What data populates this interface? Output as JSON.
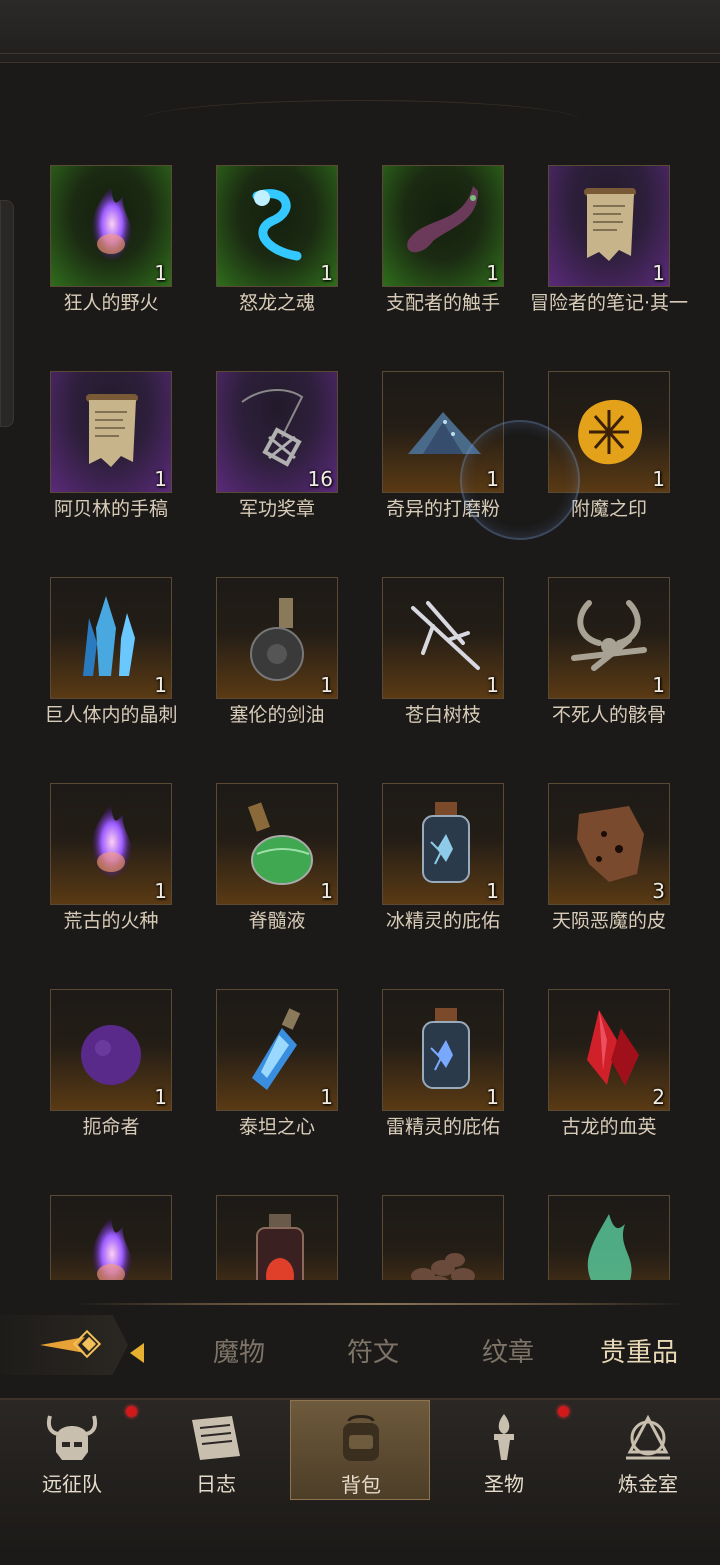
{
  "items": [
    {
      "name": "狂人的野火",
      "count": "1",
      "bg": "green",
      "icon": "purple-flame-icon",
      "color": "#9b5cff"
    },
    {
      "name": "怒龙之魂",
      "count": "1",
      "bg": "green",
      "icon": "blue-spirit-icon",
      "color": "#33c8ff"
    },
    {
      "name": "支配者的触手",
      "count": "1",
      "bg": "green",
      "icon": "tentacle-icon",
      "color": "#6b3a5a"
    },
    {
      "name": "冒险者的笔记·其一",
      "count": "1",
      "bg": "purple",
      "icon": "scroll-icon",
      "color": "#c8b48a"
    },
    {
      "name": "阿贝林的手稿",
      "count": "1",
      "bg": "purple",
      "icon": "scroll-icon",
      "color": "#c8b48a"
    },
    {
      "name": "军功奖章",
      "count": "16",
      "bg": "purple",
      "icon": "medal-icon",
      "color": "#b0b0b0"
    },
    {
      "name": "奇异的打磨粉",
      "count": "1",
      "bg": "orange",
      "icon": "powder-pile-icon",
      "color": "#4a6a8a"
    },
    {
      "name": "附魔之印",
      "count": "1",
      "bg": "orange",
      "icon": "amber-sigil-icon",
      "color": "#e3a21a"
    },
    {
      "name": "巨人体内的晶刺",
      "count": "1",
      "bg": "orange",
      "icon": "crystal-shard-icon",
      "color": "#4aa8e0"
    },
    {
      "name": "塞伦的剑油",
      "count": "1",
      "bg": "orange",
      "icon": "oil-flask-icon",
      "color": "#3a3a3a"
    },
    {
      "name": "苍白树枝",
      "count": "1",
      "bg": "orange",
      "icon": "branch-icon",
      "color": "#d8d8e0"
    },
    {
      "name": "不死人的骸骨",
      "count": "1",
      "bg": "orange",
      "icon": "bones-icon",
      "color": "#a8a294"
    },
    {
      "name": "荒古的火种",
      "count": "1",
      "bg": "orange",
      "icon": "purple-fire-icon",
      "color": "#b04cff"
    },
    {
      "name": "脊髓液",
      "count": "1",
      "bg": "orange",
      "icon": "green-potion-icon",
      "color": "#3fa850"
    },
    {
      "name": "冰精灵的庇佑",
      "count": "1",
      "bg": "orange",
      "icon": "ice-jar-icon",
      "color": "#8ecbe8"
    },
    {
      "name": "天陨恶魔的皮",
      "count": "3",
      "bg": "orange",
      "icon": "demon-hide-icon",
      "color": "#7a4a2e"
    },
    {
      "name": "扼命者",
      "count": "1",
      "bg": "orange",
      "icon": "dark-orb-icon",
      "color": "#5a2a8a"
    },
    {
      "name": "泰坦之心",
      "count": "1",
      "bg": "orange",
      "icon": "blue-crystal-vial-icon",
      "color": "#3a8ee0"
    },
    {
      "name": "雷精灵的庇佑",
      "count": "1",
      "bg": "orange",
      "icon": "thunder-jar-icon",
      "color": "#7aa8ff"
    },
    {
      "name": "古龙的血英",
      "count": "2",
      "bg": "orange",
      "icon": "red-crystal-icon",
      "color": "#d0202a"
    },
    {
      "name": "",
      "count": "",
      "bg": "orange",
      "icon": "purple-fire-icon",
      "color": "#b04cff"
    },
    {
      "name": "",
      "count": "",
      "bg": "orange",
      "icon": "red-lantern-icon",
      "color": "#e0402a"
    },
    {
      "name": "",
      "count": "",
      "bg": "orange",
      "icon": "coal-pile-icon",
      "color": "#6a4a3a"
    },
    {
      "name": "",
      "count": "",
      "bg": "orange",
      "icon": "green-flame-icon",
      "color": "#5ad0a0"
    }
  ],
  "tabs": [
    {
      "label": "魔物",
      "active": false
    },
    {
      "label": "符文",
      "active": false
    },
    {
      "label": "纹章",
      "active": false
    },
    {
      "label": "贵重品",
      "active": true
    }
  ],
  "nav": [
    {
      "label": "远征队",
      "icon": "viking-helmet-icon",
      "badge": true,
      "active": false
    },
    {
      "label": "日志",
      "icon": "journal-map-icon",
      "badge": false,
      "active": false
    },
    {
      "label": "背包",
      "icon": "backpack-icon",
      "badge": false,
      "active": true
    },
    {
      "label": "圣物",
      "icon": "torch-relic-icon",
      "badge": true,
      "active": false
    },
    {
      "label": "炼金室",
      "icon": "alchemy-icon",
      "badge": false,
      "active": false
    }
  ],
  "colors": {
    "accent": "#e9d9b6",
    "badge": "#d11919",
    "active_nav": "#6e5a3c"
  }
}
